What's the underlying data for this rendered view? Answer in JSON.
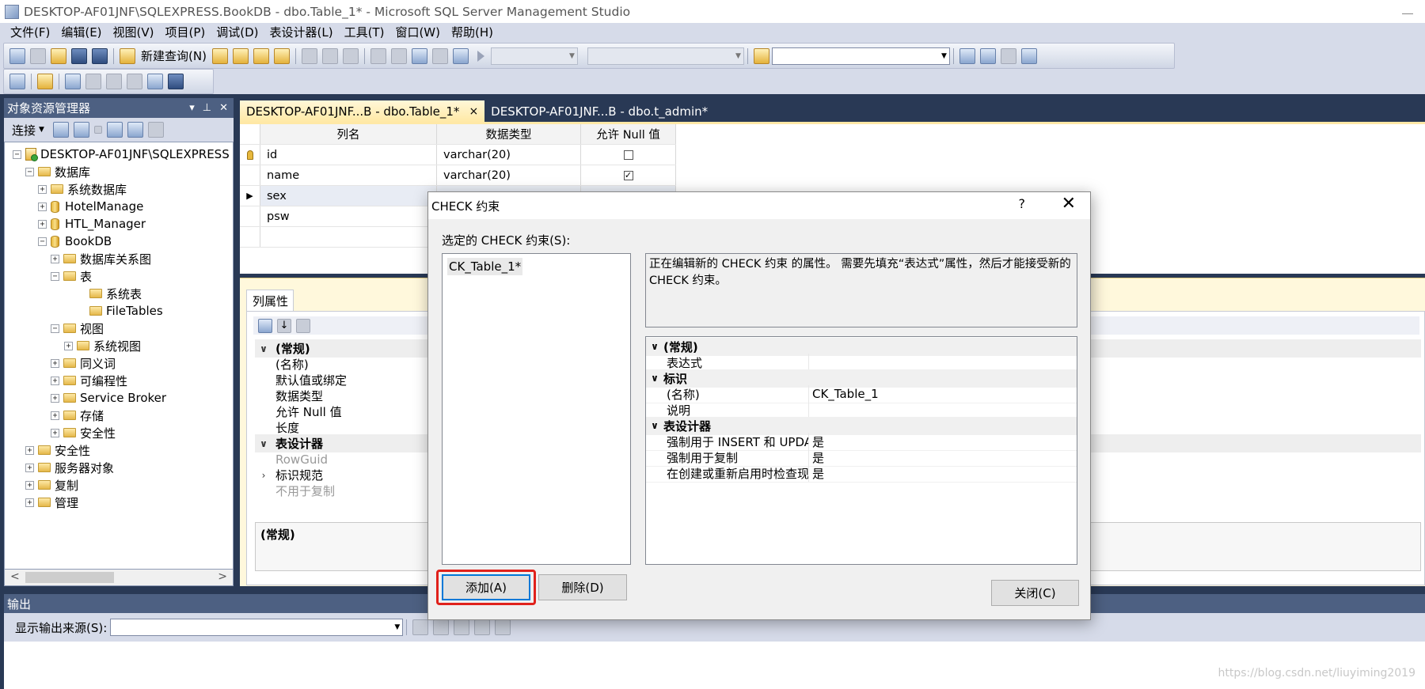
{
  "window": {
    "title": "DESKTOP-AF01JNF\\SQLEXPRESS.BookDB - dbo.Table_1* - Microsoft SQL Server Management Studio"
  },
  "menu": [
    "文件(F)",
    "编辑(E)",
    "视图(V)",
    "项目(P)",
    "调试(D)",
    "表设计器(L)",
    "工具(T)",
    "窗口(W)",
    "帮助(H)"
  ],
  "toolbar": {
    "new_query": "新建查询(N)"
  },
  "object_explorer": {
    "title": "对象资源管理器",
    "connect": "连接",
    "tree": [
      {
        "label": "DESKTOP-AF01JNF\\SQLEXPRESS",
        "icon": "server-icon",
        "expander": "−"
      },
      {
        "label": "数据库",
        "icon": "folder-icon",
        "expander": "−"
      },
      {
        "label": "系统数据库",
        "icon": "folder-icon",
        "expander": "+"
      },
      {
        "label": "HotelManage",
        "icon": "database-icon",
        "expander": "+"
      },
      {
        "label": "HTL_Manager",
        "icon": "database-icon",
        "expander": "+"
      },
      {
        "label": "BookDB",
        "icon": "database-icon",
        "expander": "−"
      },
      {
        "label": "数据库关系图",
        "icon": "folder-icon",
        "expander": "+"
      },
      {
        "label": "表",
        "icon": "folder-icon",
        "expander": "−"
      },
      {
        "label": "系统表",
        "icon": "folder-icon",
        "expander": ""
      },
      {
        "label": "FileTables",
        "icon": "folder-icon",
        "expander": ""
      },
      {
        "label": "视图",
        "icon": "folder-icon",
        "expander": "−"
      },
      {
        "label": "系统视图",
        "icon": "folder-icon",
        "expander": "+"
      },
      {
        "label": "同义词",
        "icon": "folder-icon",
        "expander": "+"
      },
      {
        "label": "可编程性",
        "icon": "folder-icon",
        "expander": "+"
      },
      {
        "label": "Service Broker",
        "icon": "folder-icon",
        "expander": "+"
      },
      {
        "label": "存储",
        "icon": "folder-icon",
        "expander": "+"
      },
      {
        "label": "安全性",
        "icon": "folder-icon",
        "expander": "+"
      },
      {
        "label": "安全性",
        "icon": "folder-icon",
        "expander": "+"
      },
      {
        "label": "服务器对象",
        "icon": "folder-icon",
        "expander": "+"
      },
      {
        "label": "复制",
        "icon": "folder-icon",
        "expander": "+"
      },
      {
        "label": "管理",
        "icon": "folder-icon",
        "expander": "+"
      }
    ]
  },
  "tabs": [
    {
      "label": "DESKTOP-AF01JNF...B - dbo.Table_1*",
      "close": "×"
    },
    {
      "label": "DESKTOP-AF01JNF...B - dbo.t_admin*"
    }
  ],
  "designer": {
    "headers": {
      "name": "列名",
      "type": "数据类型",
      "null": "允许 Null 值"
    },
    "rows": [
      {
        "name": "id",
        "type": "varchar(20)",
        "null": "",
        "marker": "key"
      },
      {
        "name": "name",
        "type": "varchar(20)",
        "null": "✓",
        "marker": ""
      },
      {
        "name": "sex",
        "type": "",
        "null": "",
        "marker": "current"
      },
      {
        "name": "psw",
        "type": "",
        "null": "",
        "marker": ""
      }
    ]
  },
  "column_properties": {
    "tab": "列属性",
    "rows": [
      {
        "label": "(常规)",
        "kind": "cat",
        "chev": "∨"
      },
      {
        "label": "(名称)",
        "kind": "item",
        "chev": ""
      },
      {
        "label": "默认值或绑定",
        "kind": "item",
        "chev": ""
      },
      {
        "label": "数据类型",
        "kind": "item",
        "chev": ""
      },
      {
        "label": "允许 Null 值",
        "kind": "item",
        "chev": ""
      },
      {
        "label": "长度",
        "kind": "item",
        "chev": ""
      },
      {
        "label": "表设计器",
        "kind": "cat",
        "chev": "∨"
      },
      {
        "label": "RowGuid",
        "kind": "dim",
        "chev": ""
      },
      {
        "label": "标识规范",
        "kind": "item",
        "chev": "›"
      },
      {
        "label": "不用于复制",
        "kind": "dim",
        "chev": ""
      }
    ],
    "description": "(常规)"
  },
  "output": {
    "title": "输出",
    "source_label": "显示输出来源(S):"
  },
  "dialog": {
    "title": "CHECK 约束",
    "help": "?",
    "close_x": "✕",
    "list_label": "选定的 CHECK 约束(S):",
    "list_items": [
      "CK_Table_1*"
    ],
    "description": "正在编辑新的 CHECK 约束 的属性。 需要先填充“表达式”属性，然后才能接受新的 CHECK 约束。",
    "properties": [
      {
        "key": "(常规)",
        "value": "",
        "kind": "cat"
      },
      {
        "key": "表达式",
        "value": "",
        "kind": "item"
      },
      {
        "key": "标识",
        "value": "",
        "kind": "cat"
      },
      {
        "key": "(名称)",
        "value": "CK_Table_1",
        "kind": "item"
      },
      {
        "key": "说明",
        "value": "",
        "kind": "item"
      },
      {
        "key": "表设计器",
        "value": "",
        "kind": "cat"
      },
      {
        "key": "强制用于 INSERT 和 UPDATE",
        "value": "是",
        "kind": "item"
      },
      {
        "key": "强制用于复制",
        "value": "是",
        "kind": "item"
      },
      {
        "key": "在创建或重新启用时检查现有数据",
        "value": "是",
        "kind": "item"
      }
    ],
    "add_button": "添加(A)",
    "delete_button": "删除(D)",
    "close_button": "关闭(C)"
  },
  "watermark": "https://blog.csdn.net/liuyiming2019"
}
